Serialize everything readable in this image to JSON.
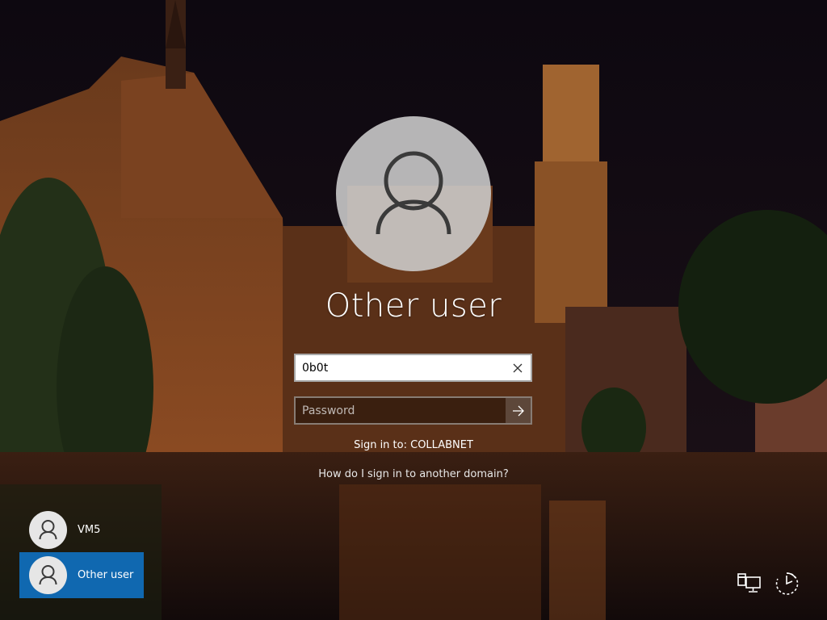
{
  "login": {
    "user_display_name": "Other user",
    "username_value": "0b0t",
    "password_placeholder": "Password",
    "sign_in_target": "Sign in to: COLLABNET",
    "domain_help_link": "How do I sign in to another domain?"
  },
  "user_list": [
    {
      "label": "VM5",
      "selected": false
    },
    {
      "label": "Other user",
      "selected": true
    }
  ],
  "icons": {
    "clear": "close-icon",
    "submit": "arrow-right-icon",
    "avatar": "user-icon",
    "network": "network-icon",
    "power": "accessibility-icon"
  },
  "colors": {
    "selected_tile": "#1068b0",
    "text": "#ffffff"
  }
}
